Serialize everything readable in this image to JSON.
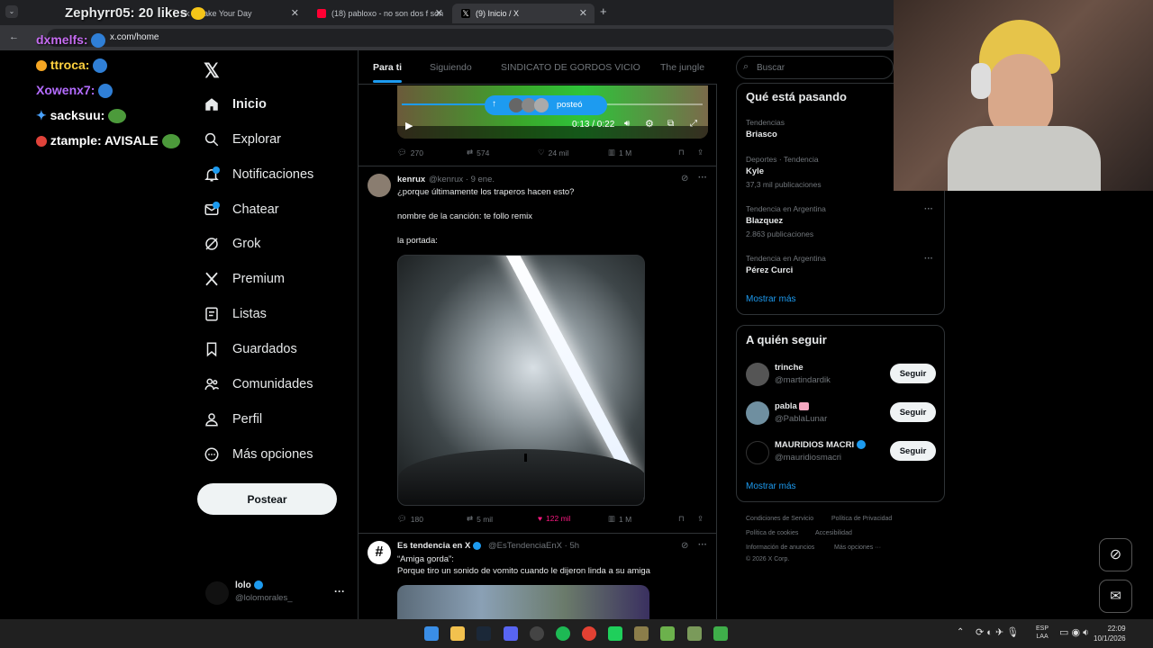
{
  "browser": {
    "tabs": [
      {
        "title": "ok - Make Your Day",
        "color": "#111"
      },
      {
        "title": "(18) pabloxo - no son dos f son",
        "color": "#ff0033"
      },
      {
        "title": "(9) Inicio / X",
        "color": "#000"
      }
    ],
    "address": "x.com/home"
  },
  "stream_chat": [
    {
      "text": "Zephyrr05: 20 likes",
      "color": "#ffffff"
    },
    {
      "text": "dxmelfs:",
      "color": "#c56cf0"
    },
    {
      "text": "ttroca:",
      "color": "#ffd23f"
    },
    {
      "text": "Xowenx7:",
      "color": "#b46cff"
    },
    {
      "text": "sacksuu:",
      "color": "#ffffff"
    },
    {
      "text": "ztample: AVISALE",
      "color": "#ffffff"
    }
  ],
  "nav": {
    "items": [
      {
        "label": "Inicio",
        "icon": "home-icon"
      },
      {
        "label": "Explorar",
        "icon": "search-icon"
      },
      {
        "label": "Notificaciones",
        "icon": "bell-icon"
      },
      {
        "label": "Chatear",
        "icon": "mail-icon"
      },
      {
        "label": "Grok",
        "icon": "grok-icon"
      },
      {
        "label": "Premium",
        "icon": "x-logo-icon"
      },
      {
        "label": "Listas",
        "icon": "list-icon"
      },
      {
        "label": "Guardados",
        "icon": "bookmark-icon"
      },
      {
        "label": "Comunidades",
        "icon": "people-icon"
      },
      {
        "label": "Perfil",
        "icon": "person-icon"
      },
      {
        "label": "Más opciones",
        "icon": "more-circle-icon"
      }
    ],
    "post_label": "Postear",
    "account": {
      "name": "lolo",
      "handle": "@lolomorales_"
    }
  },
  "feed": {
    "tabs": [
      "Para ti",
      "Siguiendo",
      "SINDICATO DE GORDOS VICIO",
      "The jungle"
    ],
    "video": {
      "time": "0:13 / 0:22",
      "posted_label": "posteó"
    },
    "post1_actions": {
      "replies": "270",
      "reposts": "574",
      "likes": "24 mil",
      "views": "1 M"
    },
    "post2": {
      "name": "kenrux",
      "meta": "@kenrux · 9 ene.",
      "line1": "¿porque últimamente los traperos hacen esto?",
      "line2": "nombre de la canción: te follo remix",
      "line3": "la portada:",
      "actions": {
        "replies": "180",
        "reposts": "5 mil",
        "likes": "122 mil",
        "views": "1 M"
      }
    },
    "post3": {
      "name": "Es tendencia en X",
      "meta": "@EsTendenciaEnX · 5h",
      "line1": "“Amiga gorda”:",
      "line2": "Porque tiro un sonido de vomito cuando le dijeron linda a su amiga"
    }
  },
  "right": {
    "search_placeholder": "Buscar",
    "trends_title": "Qué está pasando",
    "trends": [
      {
        "context": "Tendencias",
        "name": "Briasco",
        "count": ""
      },
      {
        "context": "Deportes · Tendencia",
        "name": "Kyle",
        "count": "37,3 mil publicaciones"
      },
      {
        "context": "Tendencia en Argentina",
        "name": "Blazquez",
        "count": "2.863 publicaciones"
      },
      {
        "context": "Tendencia en Argentina",
        "name": "Pérez Curci",
        "count": ""
      }
    ],
    "show_more": "Mostrar más",
    "follow_title": "A quién seguir",
    "follow": [
      {
        "name": "trinche",
        "handle": "@martindardik"
      },
      {
        "name": "pabla",
        "handle": "@PablaLunar"
      },
      {
        "name": "MAURIDIOS MACRI",
        "handle": "@mauridiosmacri"
      }
    ],
    "follow_label": "Seguir",
    "footer": [
      "Condiciones de Servicio",
      "Política de Privacidad",
      "Política de cookies",
      "Accesibilidad",
      "Información de anuncios",
      "Más opciones ···",
      "© 2026 X Corp."
    ]
  },
  "taskbar": {
    "lang": "ESP",
    "lang2": "LAA",
    "time": "22:09",
    "date": "10/1/2026"
  }
}
